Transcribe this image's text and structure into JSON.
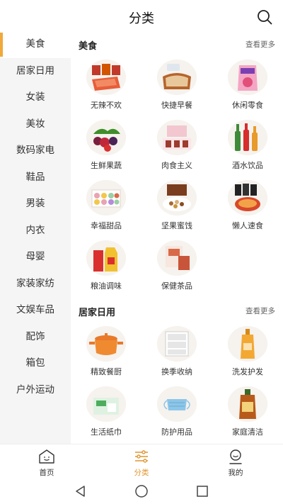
{
  "header": {
    "title": "分类"
  },
  "sidebar": {
    "items": [
      {
        "label": "美食"
      },
      {
        "label": "居家日用"
      },
      {
        "label": "女装"
      },
      {
        "label": "美妆"
      },
      {
        "label": "数码家电"
      },
      {
        "label": "鞋品"
      },
      {
        "label": "男装"
      },
      {
        "label": "内衣"
      },
      {
        "label": "母婴"
      },
      {
        "label": "家装家纺"
      },
      {
        "label": "文娱车品"
      },
      {
        "label": "配饰"
      },
      {
        "label": "箱包"
      },
      {
        "label": "户外运动"
      }
    ]
  },
  "sections": [
    {
      "title": "美食",
      "more": "查看更多",
      "items": [
        {
          "label": "无辣不欢"
        },
        {
          "label": "快捷早餐"
        },
        {
          "label": "休闲零食"
        },
        {
          "label": "生鲜果蔬"
        },
        {
          "label": "肉食主义"
        },
        {
          "label": "酒水饮品"
        },
        {
          "label": "幸福甜品"
        },
        {
          "label": "坚果蜜饯"
        },
        {
          "label": "懒人速食"
        },
        {
          "label": "粮油调味"
        },
        {
          "label": "保健茶品"
        }
      ]
    },
    {
      "title": "居家日用",
      "more": "查看更多",
      "items": [
        {
          "label": "精致餐厨"
        },
        {
          "label": "换季收纳"
        },
        {
          "label": "洗发护发"
        },
        {
          "label": "生活纸巾"
        },
        {
          "label": "防护用品"
        },
        {
          "label": "家庭清洁"
        }
      ]
    }
  ],
  "tabbar": {
    "tabs": [
      {
        "label": "首页"
      },
      {
        "label": "分类"
      },
      {
        "label": "我的"
      }
    ]
  },
  "colors": {
    "accent": "#f0a93a",
    "sidebar_bg": "#f5f5f5"
  }
}
